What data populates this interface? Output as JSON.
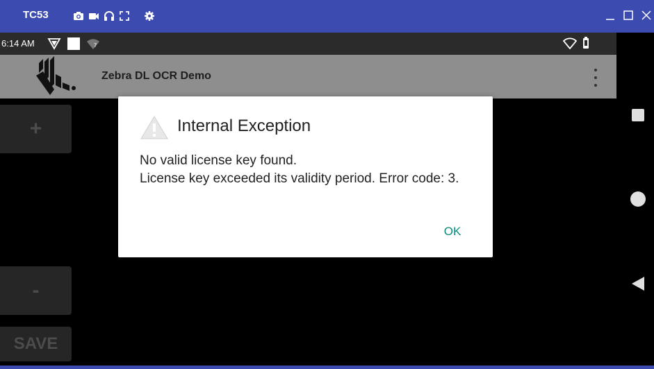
{
  "window": {
    "title": "TC53",
    "toolbar_icons": [
      "camera-icon",
      "video-icon",
      "headphones-icon",
      "fullscreen-icon",
      "gear-icon"
    ],
    "controls": [
      "minimize-icon",
      "maximize-icon",
      "close-icon"
    ]
  },
  "status_bar": {
    "time": "6:14 AM",
    "icons": [
      "shield-icon",
      "white-square-icon",
      "wifi-question-icon",
      "wifi-icon",
      "battery-icon"
    ]
  },
  "app_bar": {
    "title": "Zebra DL OCR Demo",
    "logo": "zebra-logo",
    "menu_icon": "overflow-menu-icon"
  },
  "side_buttons": {
    "plus": "+",
    "minus": "-",
    "save": "SAVE"
  },
  "dialog": {
    "title": "Internal Exception",
    "icon": "warning-icon",
    "message": "No valid license key found.\nLicense key exceeded its validity period. Error code: 3.",
    "ok_label": "OK"
  },
  "nav_bar": [
    "recent-apps-icon",
    "home-icon",
    "back-icon"
  ],
  "colors": {
    "window_bar": "#3c4bb0",
    "app_bar": "#8e8e8e",
    "accent": "#0a8a7a"
  }
}
